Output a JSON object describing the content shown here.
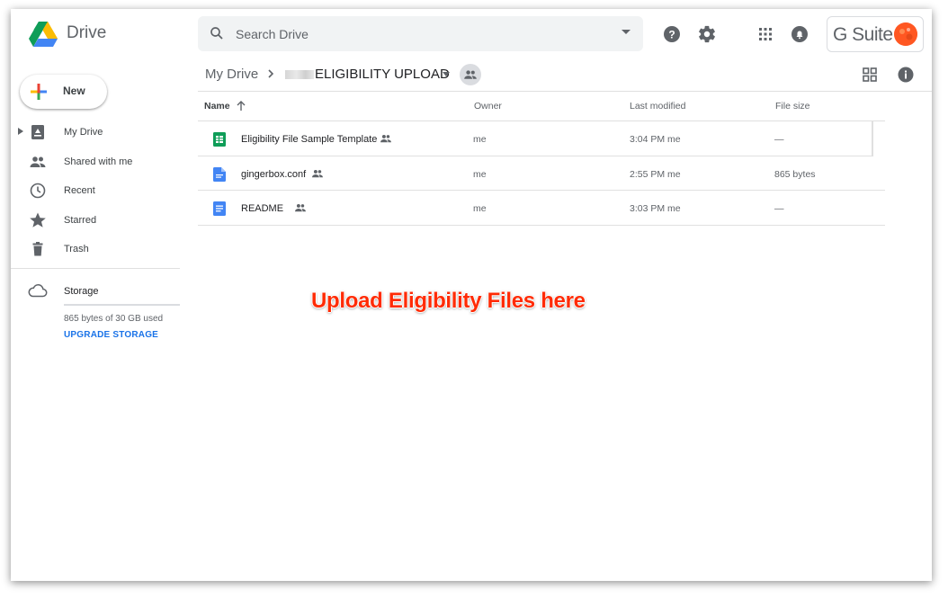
{
  "header": {
    "app_name": "Drive",
    "search_placeholder": "Search Drive",
    "gsuite_label": "G Suite"
  },
  "sidebar": {
    "new_label": "New",
    "items": [
      {
        "label": "My Drive",
        "icon": "my-drive-icon"
      },
      {
        "label": "Shared with me",
        "icon": "people-icon"
      },
      {
        "label": "Recent",
        "icon": "clock-icon"
      },
      {
        "label": "Starred",
        "icon": "star-icon"
      },
      {
        "label": "Trash",
        "icon": "trash-icon"
      }
    ],
    "storage": {
      "label": "Storage",
      "used_text": "865 bytes of 30 GB used",
      "upgrade_label": "UPGRADE STORAGE",
      "used_fraction": 3e-08
    }
  },
  "breadcrumb": {
    "root": "My Drive",
    "folder": "ELIGIBILITY UPLOAD"
  },
  "table": {
    "columns": [
      "Name",
      "Owner",
      "Last modified",
      "File size"
    ],
    "sort": {
      "column": "Name",
      "direction": "ascending"
    },
    "rows": [
      {
        "name": "Eligibility File Sample Template",
        "type": "sheets",
        "shared": true,
        "owner": "me",
        "modified": "3:04 PM me",
        "size": "—"
      },
      {
        "name": "gingerbox.conf",
        "type": "file",
        "shared": true,
        "owner": "me",
        "modified": "2:55 PM me",
        "size": "865 bytes"
      },
      {
        "name": "README",
        "type": "docs",
        "shared": true,
        "owner": "me",
        "modified": "3:03 PM me",
        "size": "—"
      }
    ]
  },
  "annotation": "Upload Eligibility Files here",
  "colors": {
    "accent": "#1a73e8",
    "annotation": "#ff2b05",
    "sheets": "#0f9d58",
    "docs": "#4285f4",
    "avatar": "#ff5722"
  }
}
